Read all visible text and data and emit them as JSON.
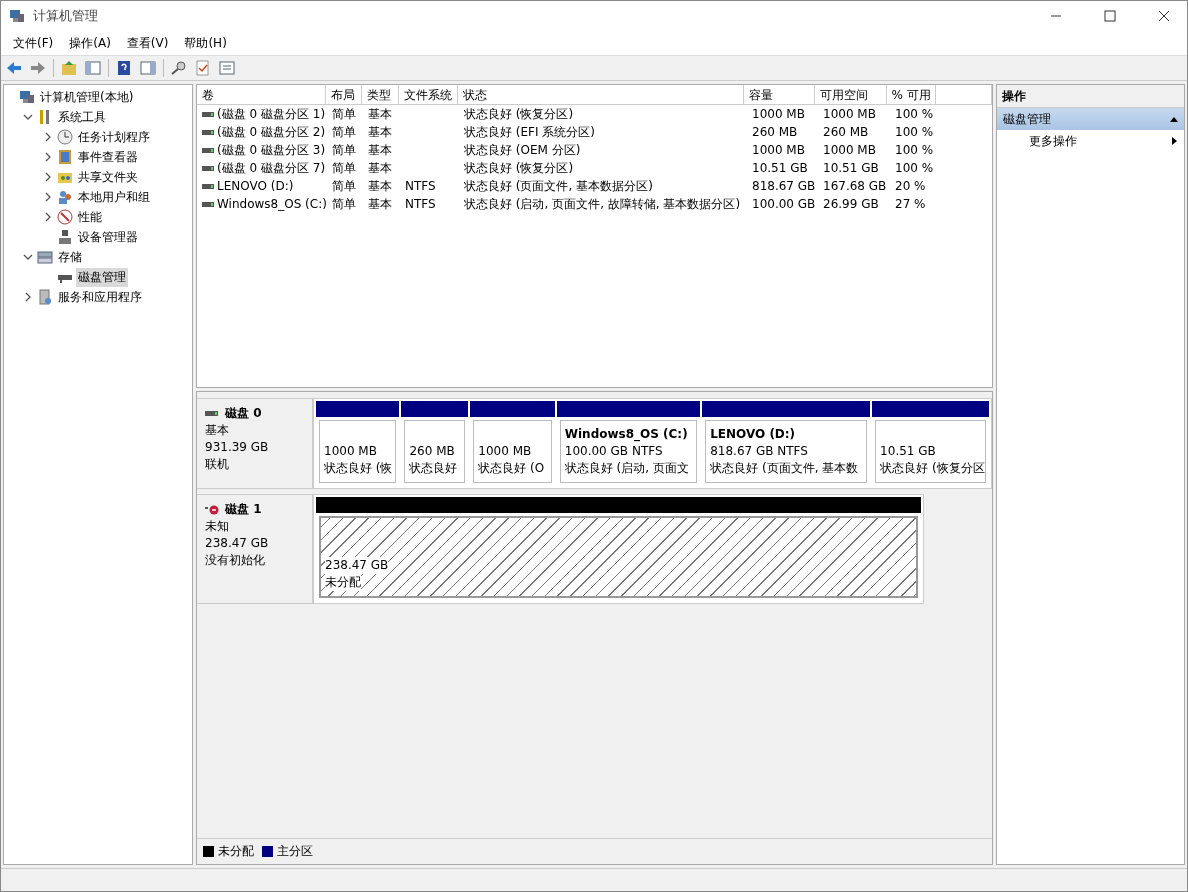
{
  "window": {
    "title": "计算机管理"
  },
  "menu": [
    "文件(F)",
    "操作(A)",
    "查看(V)",
    "帮助(H)"
  ],
  "tree": [
    {
      "label": "计算机管理(本地)",
      "kind": "computer",
      "selected": false,
      "children": [
        {
          "label": "系统工具",
          "kind": "tools",
          "expanded": true,
          "selected": false,
          "children": [
            {
              "label": "任务计划程序",
              "kind": "clock",
              "expanded": false,
              "selected": false
            },
            {
              "label": "事件查看器",
              "kind": "log",
              "expanded": false,
              "selected": false
            },
            {
              "label": "共享文件夹",
              "kind": "share",
              "expanded": false,
              "selected": false
            },
            {
              "label": "本地用户和组",
              "kind": "users",
              "expanded": false,
              "selected": false
            },
            {
              "label": "性能",
              "kind": "perf",
              "expanded": false,
              "selected": false
            },
            {
              "label": "设备管理器",
              "kind": "device",
              "selected": false
            }
          ]
        },
        {
          "label": "存储",
          "kind": "storage",
          "expanded": true,
          "selected": false,
          "children": [
            {
              "label": "磁盘管理",
              "kind": "disk",
              "selected": true
            }
          ]
        },
        {
          "label": "服务和应用程序",
          "kind": "services",
          "expanded": false,
          "selected": false
        }
      ]
    }
  ],
  "table": {
    "columns": [
      "卷",
      "布局",
      "类型",
      "文件系统",
      "状态",
      "容量",
      "可用空间",
      "% 可用"
    ],
    "rows": [
      [
        "(磁盘 0 磁盘分区 1)",
        "简单",
        "基本",
        "",
        "状态良好 (恢复分区)",
        "1000 MB",
        "1000 MB",
        "100 %"
      ],
      [
        "(磁盘 0 磁盘分区 2)",
        "简单",
        "基本",
        "",
        "状态良好 (EFI 系统分区)",
        "260 MB",
        "260 MB",
        "100 %"
      ],
      [
        "(磁盘 0 磁盘分区 3)",
        "简单",
        "基本",
        "",
        "状态良好 (OEM 分区)",
        "1000 MB",
        "1000 MB",
        "100 %"
      ],
      [
        "(磁盘 0 磁盘分区 7)",
        "简单",
        "基本",
        "",
        "状态良好 (恢复分区)",
        "10.51 GB",
        "10.51 GB",
        "100 %"
      ],
      [
        "LENOVO (D:)",
        "简单",
        "基本",
        "NTFS",
        "状态良好 (页面文件, 基本数据分区)",
        "818.67 GB",
        "167.68 GB",
        "20 %"
      ],
      [
        "Windows8_OS (C:)",
        "简单",
        "基本",
        "NTFS",
        "状态良好 (启动, 页面文件, 故障转储, 基本数据分区)",
        "100.00 GB",
        "26.99 GB",
        "27 %"
      ]
    ]
  },
  "disks": [
    {
      "name": "磁盘 0",
      "kind": "online",
      "type": "基本",
      "size": "931.39 GB",
      "status": "联机",
      "partitions": [
        {
          "kind": "primary",
          "size": "1000 MB",
          "status": "状态良好 (恢"
        },
        {
          "kind": "primary",
          "size": "260 MB",
          "status": "状态良好"
        },
        {
          "kind": "primary",
          "size": "1000 MB",
          "status": "状态良好 (O"
        },
        {
          "kind": "primary",
          "title": "Windows8_OS  (C:)",
          "size": "100.00 GB NTFS",
          "status": "状态良好 (启动, 页面文"
        },
        {
          "kind": "primary",
          "title": "LENOVO  (D:)",
          "size": "818.67 GB NTFS",
          "status": "状态良好 (页面文件, 基本数"
        },
        {
          "kind": "primary",
          "size": "10.51 GB",
          "status": "状态良好 (恢复分区"
        }
      ]
    },
    {
      "name": "磁盘 1",
      "kind": "not-initialized",
      "type": "未知",
      "size": "238.47 GB",
      "status": "没有初始化",
      "partitions": [
        {
          "kind": "unallocated",
          "size": "238.47 GB",
          "status": "未分配"
        }
      ]
    }
  ],
  "legend": [
    {
      "label": "未分配",
      "color": "#000000"
    },
    {
      "label": "主分区",
      "color": "#000080"
    }
  ],
  "actions": {
    "title": "操作",
    "section": "磁盘管理",
    "items": [
      "更多操作"
    ]
  }
}
